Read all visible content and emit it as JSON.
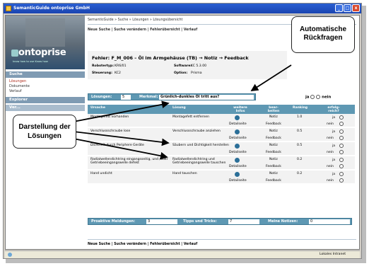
{
  "window": {
    "title": "SemanticGuide  ontoprise GmbH",
    "min_label": "_",
    "max_label": "□",
    "close_label": "x"
  },
  "sidebar": {
    "brand": "ontoprise",
    "slogan": "know how to use Know how",
    "sections": [
      {
        "title": "Suche",
        "items": [
          "Lösungen",
          "Dokumente",
          "Verlauf"
        ]
      },
      {
        "title": "Explorer",
        "items": []
      },
      {
        "title": "Ver...",
        "items": []
      }
    ]
  },
  "nav": {
    "breadcrumb": "SemanticGuide » Suche » Lösungen » Lösungsübersicht",
    "links": "Neue Suche | Suche verändern | Fehlerübersicht | Verlauf",
    "footer": "Neue Suche | Suche verändern | Fehlerübersicht | Verlauf"
  },
  "error": {
    "title": "Fehler: F_M_006 – Öl im Armgehäuse (TB) → Notiz → Feedback",
    "meta": [
      {
        "label": "Robotertyp:",
        "value": "KR6/01"
      },
      {
        "label": "Software:",
        "value": "KC 5.3.00"
      },
      {
        "label": "Steuerung:",
        "value": "KC2"
      },
      {
        "label": "Option:",
        "value": "Prisma"
      }
    ]
  },
  "solutions_bar": {
    "label": "Lösungen:",
    "count": "5",
    "feature_label": "Merkmal:",
    "question": "Grünlich-dunkles Öl tritt aus?",
    "yes": "ja",
    "no": "nein"
  },
  "table": {
    "headers": [
      "Ursache",
      "Lösung",
      "weitere Infos",
      "bear-beiten",
      "Ranking",
      "erfolg-reich?"
    ],
    "rows": [
      {
        "cause": "Montagefett vorhanden",
        "solution": "Montagefett entfernen",
        "info": "Detailseite",
        "edit": "Notiz",
        "feedback": "Feedback",
        "rank": "1.0",
        "ja": "ja",
        "nein": "nein"
      },
      {
        "cause": "Verschlussschraube lose",
        "solution": "Verschlussschraube anziehen",
        "info": "Detailseite",
        "edit": "Notiz",
        "feedback": "Feedback",
        "rank": "0.5",
        "ja": "ja",
        "nein": "nein"
      },
      {
        "cause": "Dichtheit durch Periphere Geräte",
        "solution": "Säubern und Dichtigkeit herstellen",
        "info": "Detailseite",
        "edit": "Notiz",
        "feedback": "Feedback",
        "rank": "0.5",
        "ja": "ja",
        "nein": "nein"
      },
      {
        "cause": "Radialwellendichtring eingangsseitig, und /oder Getriebeeingangswelle defekt",
        "solution": "Radialwellendichtring und Getriebeeingangswelle tauschen",
        "info": "Detailseite",
        "edit": "Notiz",
        "feedback": "Feedback",
        "rank": "0.2",
        "ja": "ja",
        "nein": "nein"
      },
      {
        "cause": "Hand undicht",
        "solution": "Hand tauschen",
        "info": "Detailseite",
        "edit": "Notiz",
        "feedback": "Feedback",
        "rank": "0.2",
        "ja": "ja",
        "nein": "nein"
      }
    ]
  },
  "bottom_bar": {
    "active_label": "Proaktive Meldungen:",
    "active_value": "3",
    "tips_label": "Tipps und Tricks:",
    "tips_value": "7",
    "notes_label": "Meine Notizen:",
    "notes_value": "0"
  },
  "status": {
    "zone": "Lokales Intranet"
  },
  "callouts": {
    "top": "Automatische Rückfragen",
    "left": "Darstellung der Lösungen"
  },
  "colors": {
    "accent": "#5e98b3",
    "sidebar_head": "#7f9bb3",
    "titlebar": "#1a44b0"
  }
}
